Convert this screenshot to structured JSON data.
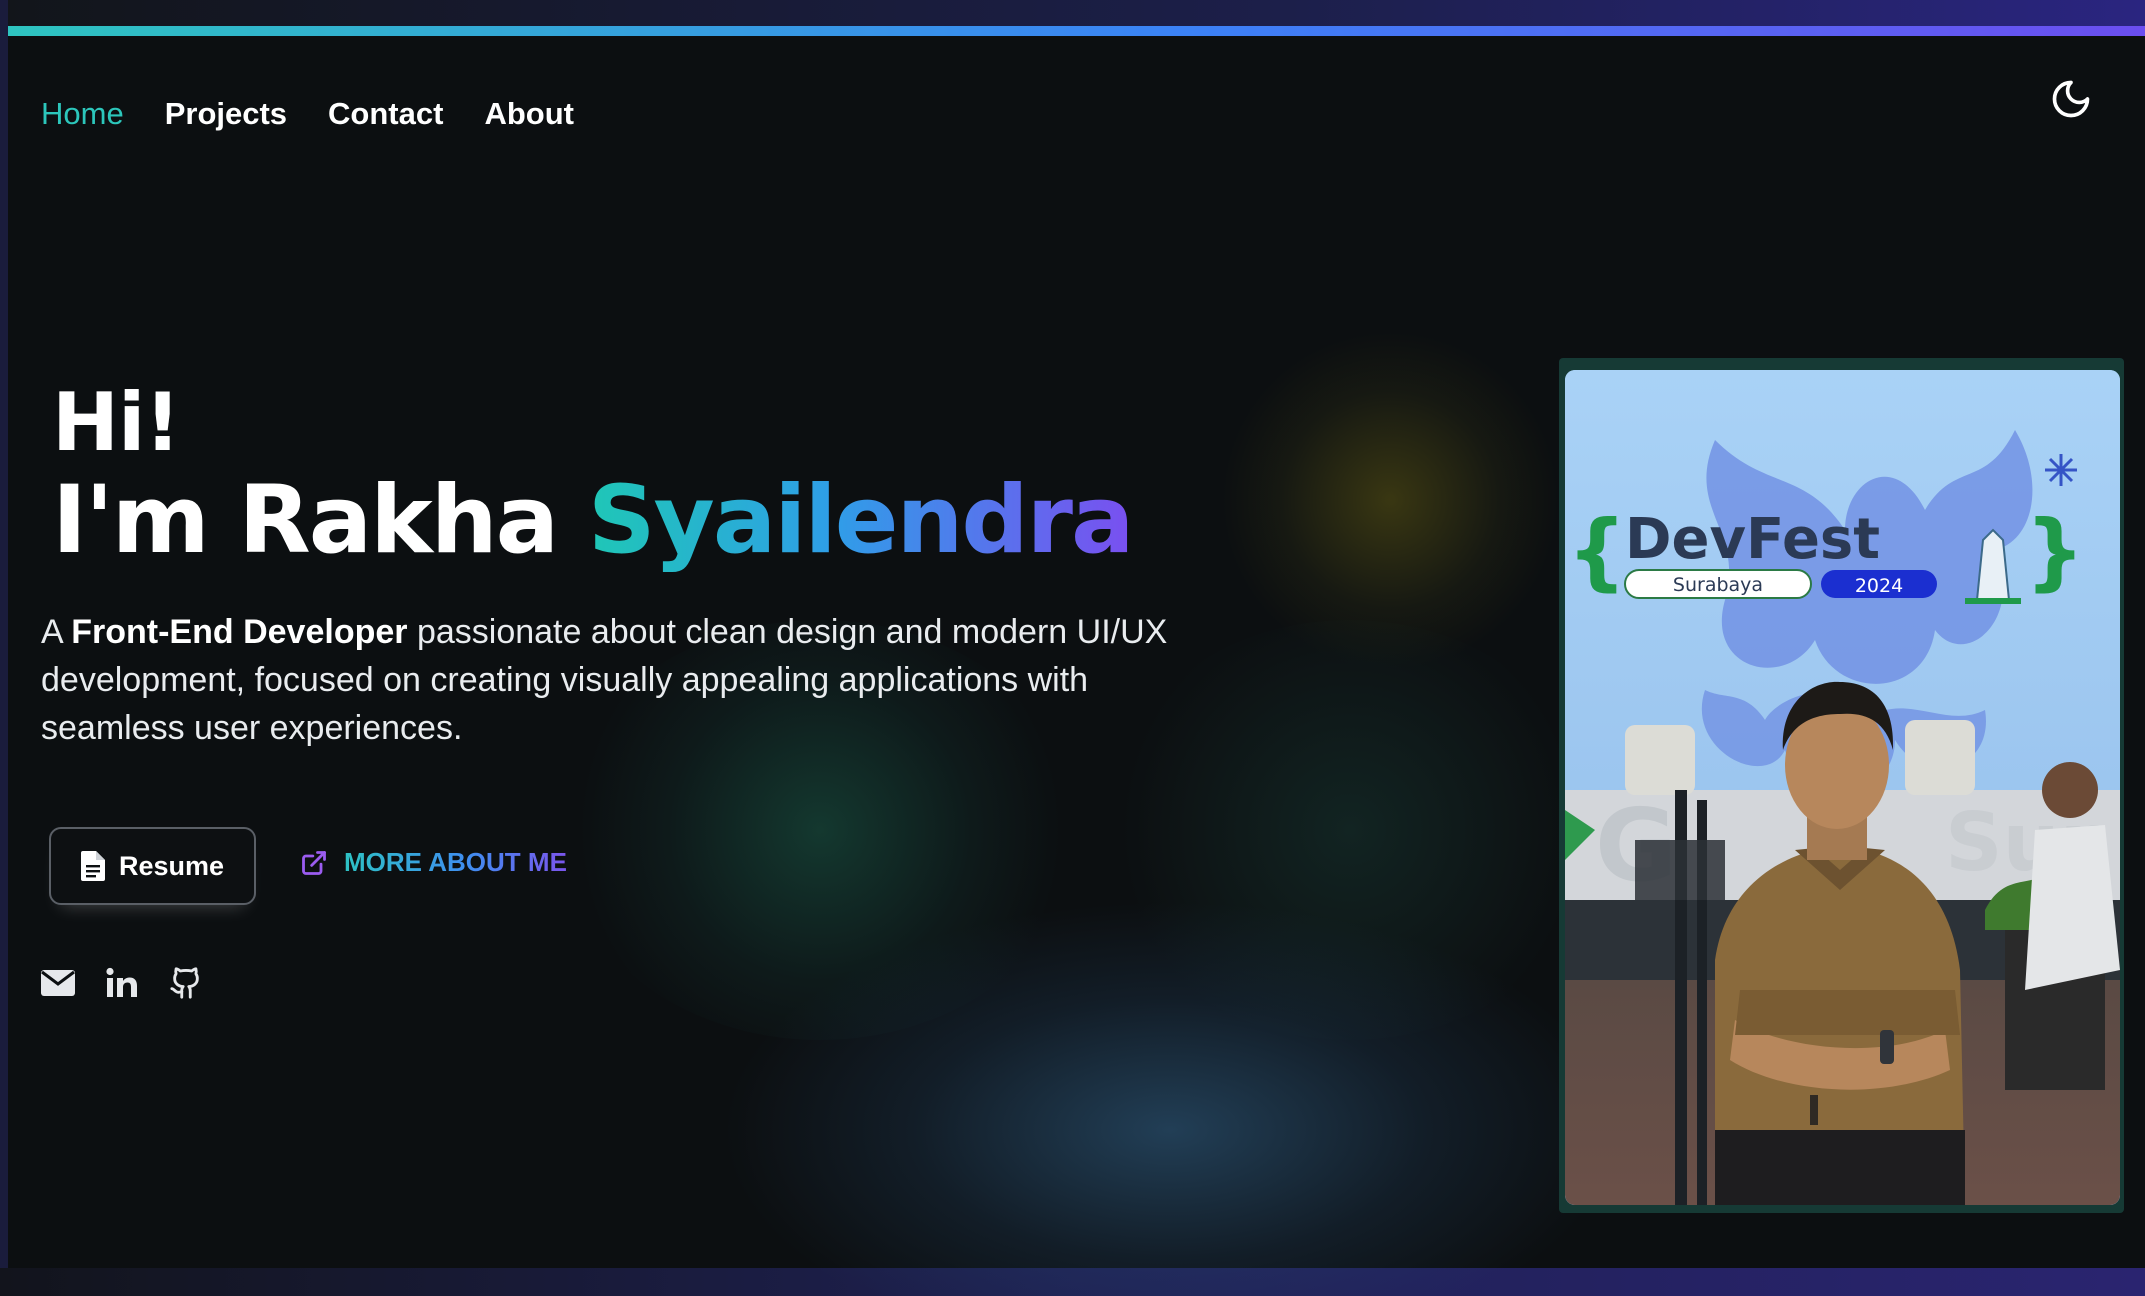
{
  "nav": {
    "items": [
      {
        "label": "Home",
        "active": true
      },
      {
        "label": "Projects",
        "active": false
      },
      {
        "label": "Contact",
        "active": false
      },
      {
        "label": "About",
        "active": false
      }
    ],
    "theme_toggle_icon": "moon-icon"
  },
  "hero": {
    "greeting": "Hi!",
    "name_prefix": "I'm Rakha",
    "name_accent": "Syailendra",
    "intro_prefix": "A ",
    "intro_role": "Front-End Developer",
    "intro_rest": " passionate about clean design and modern UI/UX development, focused on creating visually appealing applications with seamless user experiences."
  },
  "buttons": {
    "resume_label": "Resume",
    "more_label": "MORE ABOUT ME"
  },
  "socials": [
    {
      "icon": "mail-icon"
    },
    {
      "icon": "linkedin-icon"
    },
    {
      "icon": "github-icon"
    }
  ],
  "photo": {
    "event_title": "DevFest",
    "event_city": "Surabaya",
    "event_year": "2024"
  },
  "colors": {
    "accent_teal": "#2cc6bb",
    "accent_blue": "#3b82f6",
    "accent_purple": "#7a4ff0",
    "background": "#0c0f11"
  }
}
